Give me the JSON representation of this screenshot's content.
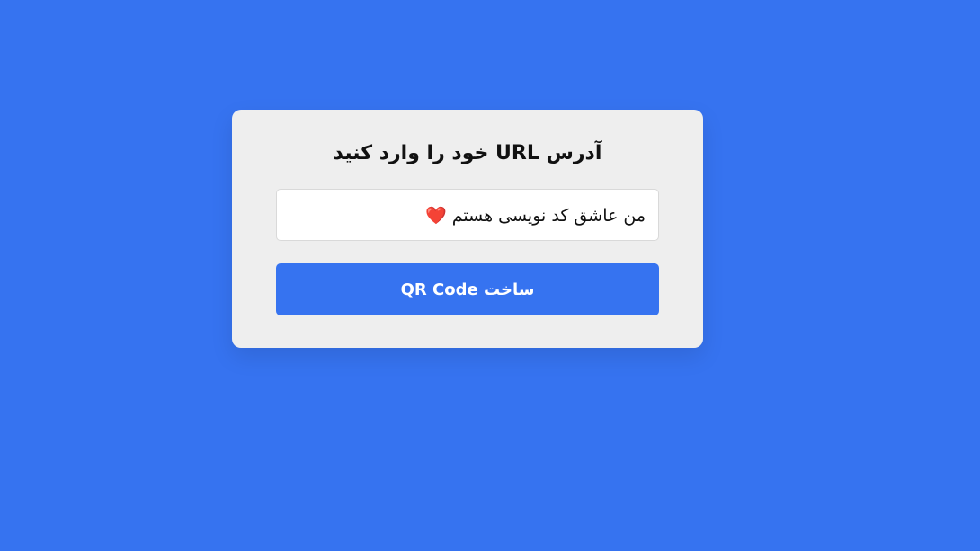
{
  "form": {
    "title": "آدرس URL خود را وارد کنید",
    "url_input_value": "من عاشق کد نویسی هستم ❤️",
    "generate_button_label": "ساخت QR Code"
  },
  "colors": {
    "background": "#3673f0",
    "card": "#eeeeee",
    "button": "#3673f0",
    "heart": "#e02230"
  },
  "icons": {
    "heart": "heart-icon"
  }
}
